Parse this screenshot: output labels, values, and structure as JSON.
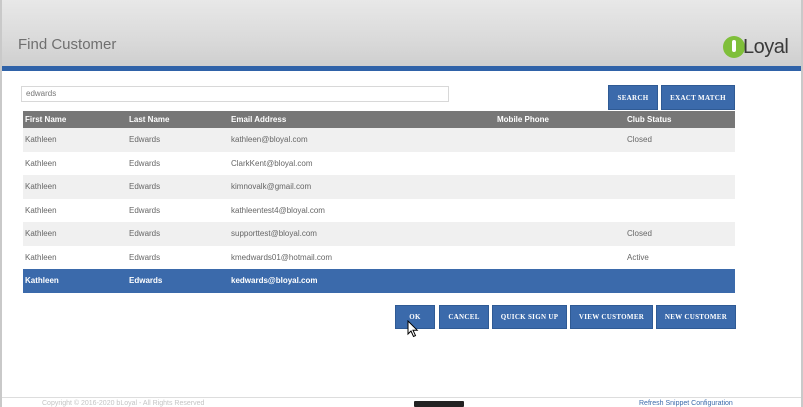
{
  "header": {
    "title": "Find Customer",
    "logo_text": "Loyal"
  },
  "search": {
    "value": "edwards",
    "search_label": "SEARCH",
    "exact_label": "EXACT MATCH"
  },
  "table": {
    "columns": [
      "First Name",
      "Last Name",
      "Email Address",
      "Mobile Phone",
      "Club Status"
    ],
    "rows": [
      [
        "Kathleen",
        "Edwards",
        "kathleen@bloyal.com",
        "",
        "Closed"
      ],
      [
        "Kathleen",
        "Edwards",
        "ClarkKent@bloyal.com",
        "",
        ""
      ],
      [
        "Kathleen",
        "Edwards",
        "kimnovalk@gmail.com",
        "",
        ""
      ],
      [
        "Kathleen",
        "Edwards",
        "kathleentest4@bloyal.com",
        "",
        ""
      ],
      [
        "Kathleen",
        "Edwards",
        "supporttest@bloyal.com",
        "",
        "Closed"
      ],
      [
        "Kathleen",
        "Edwards",
        "kmedwards01@hotmail.com",
        "",
        "Active"
      ],
      [
        "Kathleen",
        "Edwards",
        "kedwards@bloyal.com",
        "",
        ""
      ]
    ],
    "selected_index": 6
  },
  "actions": {
    "ok": "OK",
    "cancel": "CANCEL",
    "quick_sign_up": "QUICK SIGN UP",
    "view_customer": "VIEW CUSTOMER",
    "new_customer": "NEW CUSTOMER"
  },
  "footer": {
    "copyright": "Copyright © 2016-2020 bLoyal - All Rights Reserved",
    "refresh_link": "Refresh Snippet Configuration"
  },
  "colors": {
    "accent": "#3b6aab",
    "header_bar": "#2f62a8",
    "logo_green": "#7fbf3a",
    "table_header": "#777777"
  }
}
